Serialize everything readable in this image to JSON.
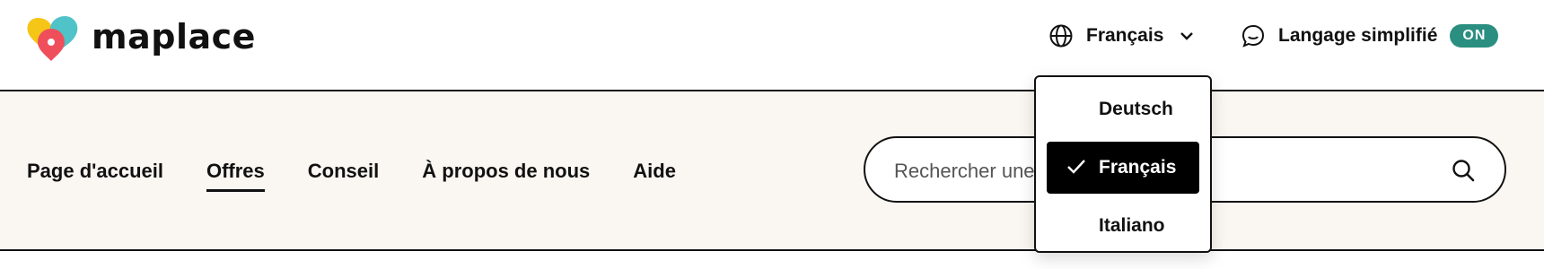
{
  "header": {
    "logo_text": "maplace",
    "language": {
      "current": "Français",
      "icon": "globe-icon"
    },
    "simple_language": {
      "label": "Langage simplifié",
      "toggle": "ON",
      "icon": "chat-bubble-icon"
    }
  },
  "nav": {
    "items": [
      {
        "label": "Page d'accueil",
        "active": false
      },
      {
        "label": "Offres",
        "active": true
      },
      {
        "label": "Conseil",
        "active": false
      },
      {
        "label": "À propos de nous",
        "active": false
      },
      {
        "label": "Aide",
        "active": false
      }
    ]
  },
  "search": {
    "placeholder": "Rechercher une offre",
    "icon": "search-icon"
  },
  "language_dropdown": {
    "options": [
      {
        "label": "Deutsch",
        "selected": false
      },
      {
        "label": "Français",
        "selected": true
      },
      {
        "label": "Italiano",
        "selected": false
      }
    ]
  },
  "colors": {
    "toggle_bg": "#2a8f80",
    "nav_band_bg": "#faf6f1",
    "logo_yellow": "#f5c518",
    "logo_teal": "#4fc3c8",
    "logo_red": "#ef4f5a"
  }
}
